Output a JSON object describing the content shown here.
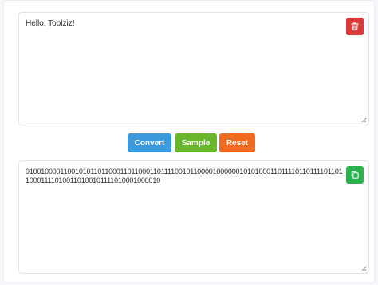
{
  "input": {
    "value": "Hello, Toolziz!",
    "clear_icon": "trash-icon"
  },
  "actions": {
    "convert_label": "Convert",
    "sample_label": "Sample",
    "reset_label": "Reset"
  },
  "output": {
    "value": "0100100001100101011011000110110001101111001011000010000001010100011011110110111101101100011110100110100101111010001000010",
    "copy_icon": "copy-icon"
  },
  "colors": {
    "convert": "#3c99dc",
    "sample": "#6ab52b",
    "reset": "#f06a1f",
    "clear": "#dc3b3b",
    "copy": "#2bb24c"
  }
}
